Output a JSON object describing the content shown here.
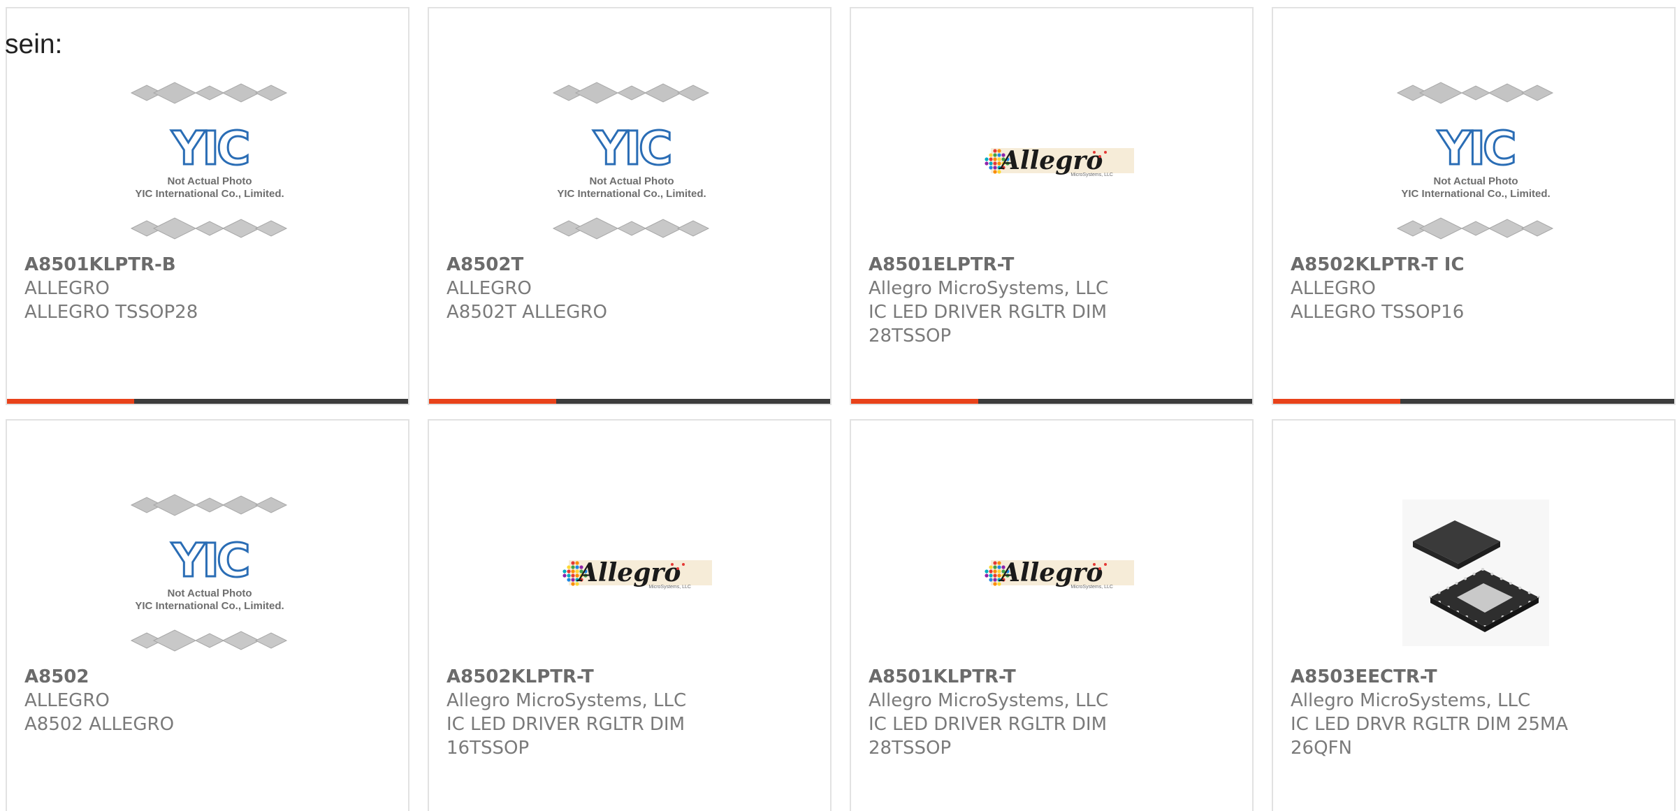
{
  "intro_text": "sein:",
  "colors": {
    "accent_orange": "#e8421a",
    "accent_dark": "#3c3c3c",
    "yic_blue": "#2a6db5",
    "text_gray": "#7a7a7a"
  },
  "products": [
    {
      "part_number": "A8501KLPTR-B",
      "manufacturer": "ALLEGRO",
      "description": "ALLEGRO TSSOP28",
      "image": "yic-placeholder-icon",
      "image_caption_1": "Not Actual Photo",
      "image_caption_2": "YIC International Co., Limited.",
      "image_logo": "YIC"
    },
    {
      "part_number": "A8502T",
      "manufacturer": "ALLEGRO",
      "description": "A8502T ALLEGRO",
      "image": "yic-placeholder-icon",
      "image_caption_1": "Not Actual Photo",
      "image_caption_2": "YIC International Co., Limited.",
      "image_logo": "YIC"
    },
    {
      "part_number": "A8501ELPTR-T",
      "manufacturer": "Allegro MicroSystems, LLC",
      "description": "IC LED DRIVER RGLTR DIM 28TSSOP",
      "image": "allegro-logo-icon",
      "image_logo": "Allegro",
      "image_logo_sub": "MicroSystems, LLC"
    },
    {
      "part_number": "A8502KLPTR-T IC",
      "manufacturer": "ALLEGRO",
      "description": "ALLEGRO TSSOP16",
      "image": "yic-placeholder-icon",
      "image_caption_1": "Not Actual Photo",
      "image_caption_2": "YIC International Co., Limited.",
      "image_logo": "YIC"
    },
    {
      "part_number": "A8502",
      "manufacturer": "ALLEGRO",
      "description": "A8502 ALLEGRO",
      "image": "yic-placeholder-icon",
      "image_caption_1": "Not Actual Photo",
      "image_caption_2": "YIC International Co., Limited.",
      "image_logo": "YIC"
    },
    {
      "part_number": "A8502KLPTR-T",
      "manufacturer": "Allegro MicroSystems, LLC",
      "description": "IC LED DRIVER RGLTR DIM 16TSSOP",
      "image": "allegro-logo-icon",
      "image_logo": "Allegro",
      "image_logo_sub": "MicroSystems, LLC"
    },
    {
      "part_number": "A8501KLPTR-T",
      "manufacturer": "Allegro MicroSystems, LLC",
      "description": "IC LED DRIVER RGLTR DIM 28TSSOP",
      "image": "allegro-logo-icon",
      "image_logo": "Allegro",
      "image_logo_sub": "MicroSystems, LLC"
    },
    {
      "part_number": "A8503EECTR-T",
      "manufacturer": "Allegro MicroSystems, LLC",
      "description": "IC LED DRVR RGLTR DIM 25MA 26QFN",
      "image": "qfn-chip-icon"
    }
  ]
}
